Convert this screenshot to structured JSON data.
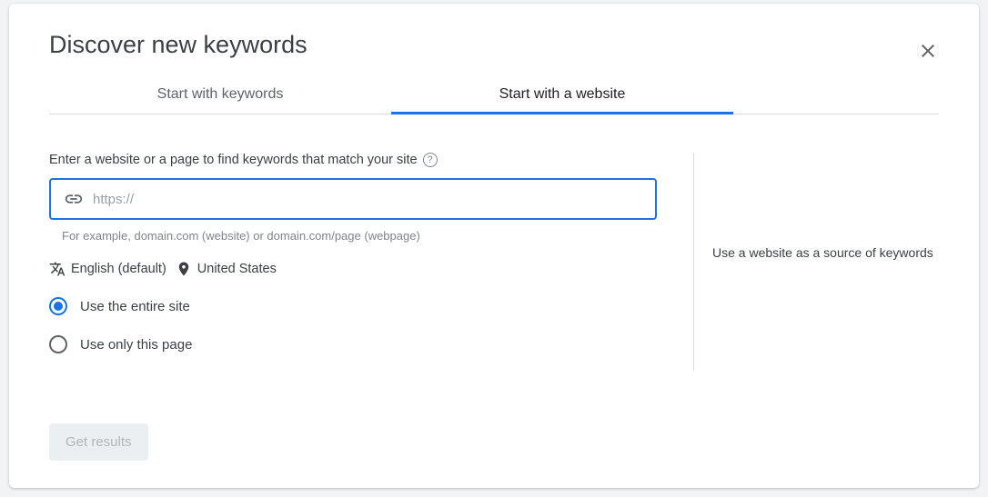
{
  "title": "Discover new keywords",
  "tabs": {
    "keywords": "Start with keywords",
    "website": "Start with a website"
  },
  "form": {
    "label": "Enter a website or a page to find keywords that match your site",
    "placeholder": "https://",
    "hint": "For example, domain.com (website) or domain.com/page (webpage)"
  },
  "meta": {
    "language": "English (default)",
    "location": "United States"
  },
  "options": {
    "entire_site": "Use the entire site",
    "only_page": "Use only this page"
  },
  "sidebar": {
    "info": "Use a website as a source of keywords"
  },
  "actions": {
    "get_results": "Get results"
  }
}
